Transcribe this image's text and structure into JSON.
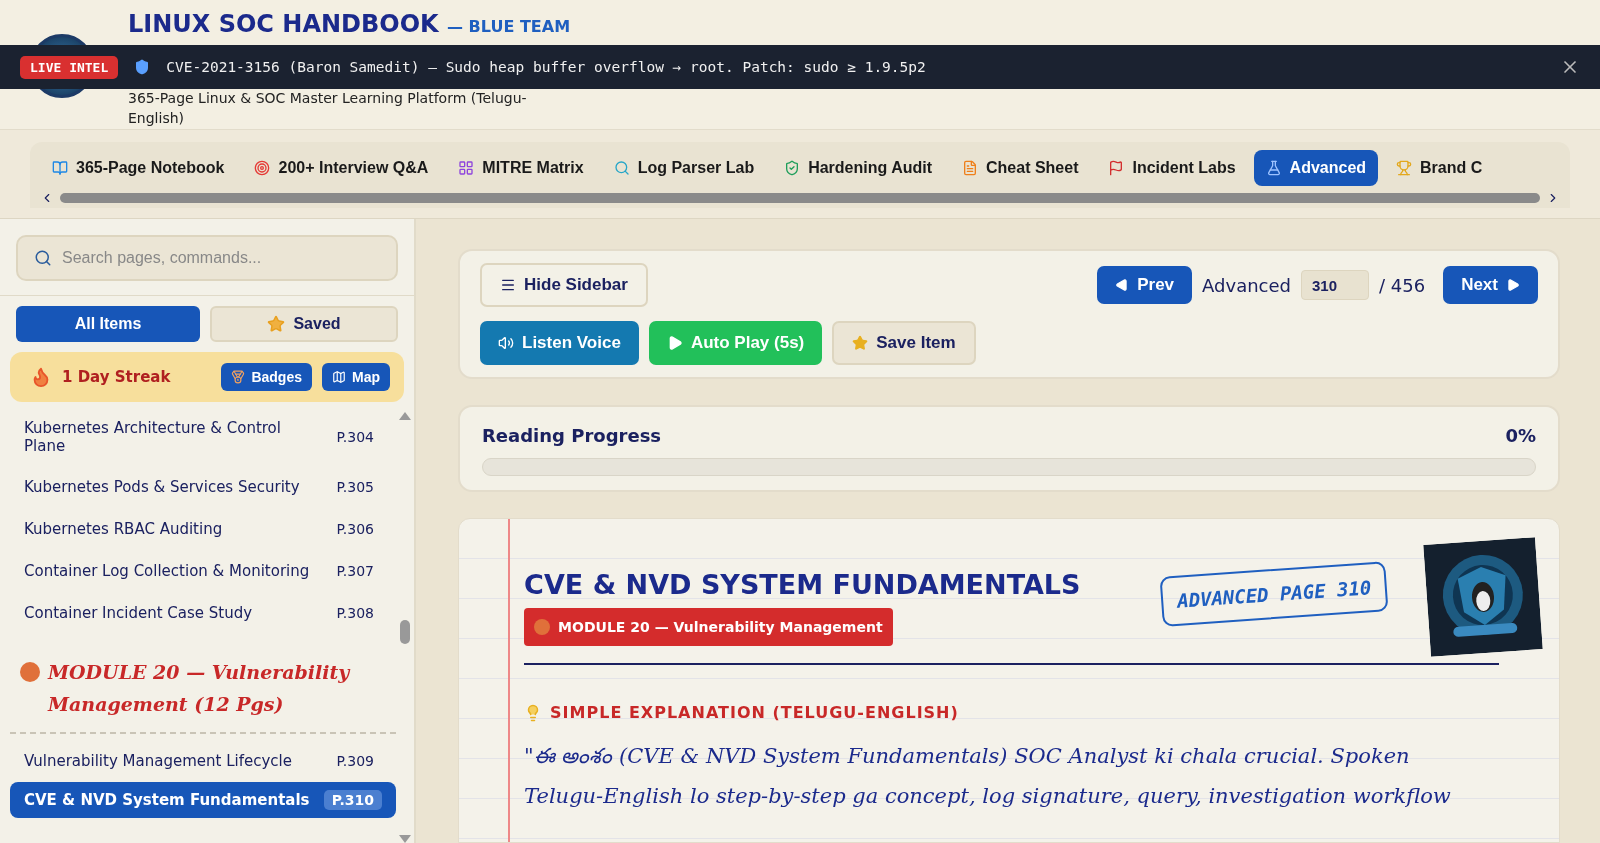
{
  "header": {
    "title": "LINUX SOC HANDBOOK",
    "tag": "— BLUE TEAM",
    "subtitle": "365-Page Linux & SOC Master Learning Platform (Telugu-English)"
  },
  "ticker": {
    "badge": "LIVE INTEL",
    "text": "CVE-2021-3156 (Baron Samedit) — Sudo heap buffer overflow → root. Patch: sudo ≥ 1.9.5p2"
  },
  "tabs": [
    {
      "label": "365-Page Notebook",
      "selected": false
    },
    {
      "label": "200+ Interview Q&A",
      "selected": false
    },
    {
      "label": "MITRE Matrix",
      "selected": false
    },
    {
      "label": "Log Parser Lab",
      "selected": false
    },
    {
      "label": "Hardening Audit",
      "selected": false
    },
    {
      "label": "Cheat Sheet",
      "selected": false
    },
    {
      "label": "Incident Labs",
      "selected": false
    },
    {
      "label": "Advanced",
      "selected": true
    },
    {
      "label": "Brand C",
      "selected": false
    }
  ],
  "sidebar": {
    "search": {
      "placeholder": "Search pages, commands..."
    },
    "filters": [
      {
        "label": "All Items",
        "selected": true
      },
      {
        "label": "Saved",
        "selected": false
      }
    ],
    "streak": {
      "label": "1 Day Streak",
      "buttons": [
        {
          "label": "Badges"
        },
        {
          "label": "Map"
        }
      ]
    },
    "items": [
      {
        "kind": "page",
        "title": "Kubernetes Architecture & Control Plane",
        "page": "P.304",
        "selected": false
      },
      {
        "kind": "page",
        "title": "Kubernetes Pods & Services Security",
        "page": "P.305",
        "selected": false
      },
      {
        "kind": "page",
        "title": "Kubernetes RBAC Auditing",
        "page": "P.306",
        "selected": false
      },
      {
        "kind": "page",
        "title": "Container Log Collection & Monitoring",
        "page": "P.307",
        "selected": false
      },
      {
        "kind": "page",
        "title": "Container Incident Case Study",
        "page": "P.308",
        "selected": false
      },
      {
        "kind": "module",
        "title": "MODULE 20 — Vulnerability Management (12 Pgs)"
      },
      {
        "kind": "page",
        "title": "Vulnerability Management Lifecycle",
        "page": "P.309",
        "selected": false
      },
      {
        "kind": "page",
        "title": "CVE & NVD System Fundamentals",
        "page": "P.310",
        "selected": true
      }
    ]
  },
  "toolbar": {
    "hide_sidebar": "Hide Sidebar",
    "actions": [
      {
        "label": "Listen Voice",
        "kind": "voice"
      },
      {
        "label": "Auto Play (5s)",
        "kind": "play"
      },
      {
        "label": "Save Item",
        "kind": "save"
      }
    ],
    "pager": {
      "prev": "Prev",
      "section": "Advanced",
      "page": "310",
      "total": "/ 456",
      "next": "Next"
    }
  },
  "progress": {
    "label": "Reading Progress",
    "reading": "0%",
    "level": 0
  },
  "page": {
    "title": "CVE & NVD SYSTEM FUNDAMENTALS",
    "stamp": "ADVANCED PAGE 310",
    "module": "MODULE 20 — Vulnerability Management",
    "section": "SIMPLE EXPLANATION (TELUGU-ENGLISH)",
    "body": "\"ఈ అంశం (CVE & NVD System Fundamentals) SOC Analyst ki chala crucial. Spoken Telugu-English lo step-by-step ga concept, log signature, query, investigation workflow"
  }
}
